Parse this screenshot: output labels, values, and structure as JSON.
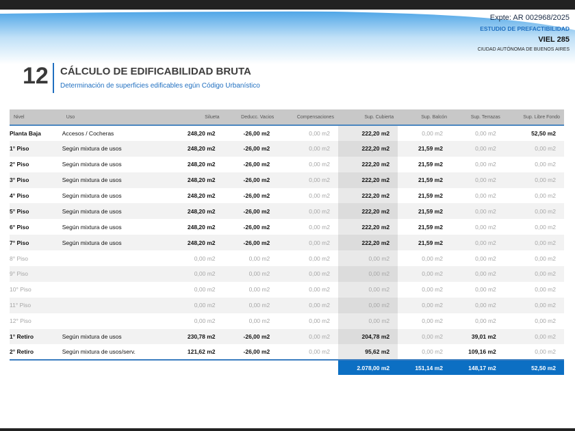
{
  "header": {
    "expte": "Expte: AR 002968/2025",
    "estudio": "ESTUDIO DE PREFACTIBILIDAD",
    "address": "VIEL 285",
    "city": "CIUDAD AUTÓNOMA DE BUENOS AIRES"
  },
  "section": {
    "number": "12",
    "title": "CÁLCULO DE EDIFICABILIDAD BRUTA",
    "subtitle": "Determinación de superficies edificables egún Código Urbanístico"
  },
  "table": {
    "columns": [
      "Nivel",
      "Uso",
      "Silueta",
      "Deducc. Vacios",
      "Compensaciones",
      "Sup. Cubierta",
      "Sup. Balcón",
      "Sup. Terrazas",
      "Sup. Libre Fondo"
    ],
    "rows": [
      [
        "Planta Baja",
        "Accesos / Cocheras",
        "248,20 m2",
        "-26,00 m2",
        "0,00 m2",
        "222,20 m2",
        "0,00 m2",
        "0,00 m2",
        "52,50 m2"
      ],
      [
        "1° Piso",
        "Según mixtura de usos",
        "248,20 m2",
        "-26,00 m2",
        "0,00 m2",
        "222,20 m2",
        "21,59 m2",
        "0,00 m2",
        "0,00 m2"
      ],
      [
        "2° Piso",
        "Según mixtura de usos",
        "248,20 m2",
        "-26,00 m2",
        "0,00 m2",
        "222,20 m2",
        "21,59 m2",
        "0,00 m2",
        "0,00 m2"
      ],
      [
        "3° Piso",
        "Según mixtura de usos",
        "248,20 m2",
        "-26,00 m2",
        "0,00 m2",
        "222,20 m2",
        "21,59 m2",
        "0,00 m2",
        "0,00 m2"
      ],
      [
        "4° Piso",
        "Según mixtura de usos",
        "248,20 m2",
        "-26,00 m2",
        "0,00 m2",
        "222,20 m2",
        "21,59 m2",
        "0,00 m2",
        "0,00 m2"
      ],
      [
        "5° Piso",
        "Según mixtura de usos",
        "248,20 m2",
        "-26,00 m2",
        "0,00 m2",
        "222,20 m2",
        "21,59 m2",
        "0,00 m2",
        "0,00 m2"
      ],
      [
        "6° Piso",
        "Según mixtura de usos",
        "248,20 m2",
        "-26,00 m2",
        "0,00 m2",
        "222,20 m2",
        "21,59 m2",
        "0,00 m2",
        "0,00 m2"
      ],
      [
        "7° Piso",
        "Según mixtura de usos",
        "248,20 m2",
        "-26,00 m2",
        "0,00 m2",
        "222,20 m2",
        "21,59 m2",
        "0,00 m2",
        "0,00 m2"
      ],
      [
        "8° Piso",
        "",
        "0,00 m2",
        "0,00 m2",
        "0,00 m2",
        "0,00 m2",
        "0,00 m2",
        "0,00 m2",
        "0,00 m2"
      ],
      [
        "9° Piso",
        "",
        "0,00 m2",
        "0,00 m2",
        "0,00 m2",
        "0,00 m2",
        "0,00 m2",
        "0,00 m2",
        "0,00 m2"
      ],
      [
        "10° Piso",
        "",
        "0,00 m2",
        "0,00 m2",
        "0,00 m2",
        "0,00 m2",
        "0,00 m2",
        "0,00 m2",
        "0,00 m2"
      ],
      [
        "11° Piso",
        "",
        "0,00 m2",
        "0,00 m2",
        "0,00 m2",
        "0,00 m2",
        "0,00 m2",
        "0,00 m2",
        "0,00 m2"
      ],
      [
        "12° Piso",
        "",
        "0,00 m2",
        "0,00 m2",
        "0,00 m2",
        "0,00 m2",
        "0,00 m2",
        "0,00 m2",
        "0,00 m2"
      ],
      [
        "1° Retiro",
        "Según mixtura de usos",
        "230,78 m2",
        "-26,00 m2",
        "0,00 m2",
        "204,78 m2",
        "0,00 m2",
        "39,01 m2",
        "0,00 m2"
      ],
      [
        "2° Retiro",
        "Según mixtura de usos/serv.",
        "121,62 m2",
        "-26,00 m2",
        "0,00 m2",
        "95,62 m2",
        "0,00 m2",
        "109,16 m2",
        "0,00 m2"
      ]
    ],
    "totals": [
      "2.078,00 m2",
      "151,14 m2",
      "148,17 m2",
      "52,50 m2"
    ]
  }
}
